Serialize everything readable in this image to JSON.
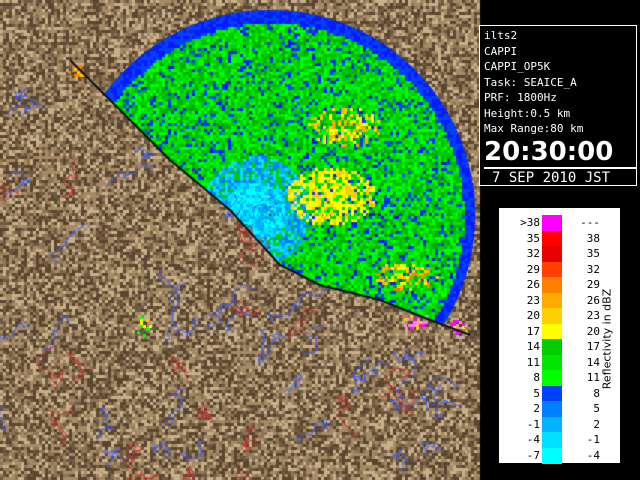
{
  "info": {
    "station": "ilts2",
    "product": "CAPPI",
    "product_code": "CAPPI_OP5K",
    "task": "Task: SEAICE_A",
    "prf": "PRF: 1800Hz",
    "height": "Height:0.5 km",
    "max_range": "Max Range:80 km",
    "time": "20:30:00",
    "date": "7 SEP 2010 JST"
  },
  "legend": {
    "unit": "Reflectivity in dBZ",
    "rows": [
      {
        "lo": ">38",
        "hi": "---",
        "color": "#ff00ff"
      },
      {
        "lo": "35",
        "hi": "38",
        "color": "#ff0000"
      },
      {
        "lo": "32",
        "hi": "35",
        "color": "#e60000"
      },
      {
        "lo": "29",
        "hi": "32",
        "color": "#ff4000"
      },
      {
        "lo": "26",
        "hi": "29",
        "color": "#ff8000"
      },
      {
        "lo": "23",
        "hi": "26",
        "color": "#ffaa00"
      },
      {
        "lo": "20",
        "hi": "23",
        "color": "#ffd000"
      },
      {
        "lo": "17",
        "hi": "20",
        "color": "#ffff00"
      },
      {
        "lo": "14",
        "hi": "17",
        "color": "#00cc00"
      },
      {
        "lo": "11",
        "hi": "14",
        "color": "#00e600"
      },
      {
        "lo": "8",
        "hi": "11",
        "color": "#00ff00"
      },
      {
        "lo": "5",
        "hi": "8",
        "color": "#0040ff"
      },
      {
        "lo": "2",
        "hi": "5",
        "color": "#0080ff"
      },
      {
        "lo": "-1",
        "hi": "2",
        "color": "#00b4ff"
      },
      {
        "lo": "-4",
        "hi": "-1",
        "color": "#00e0ff"
      },
      {
        "lo": "-7",
        "hi": "-4",
        "color": "#00ffff"
      }
    ]
  },
  "colors": {
    "terrain": "#8c7455",
    "radar_bg": "#0a1aff",
    "rivers": "#4060ff",
    "boundaries": "#c03030"
  }
}
